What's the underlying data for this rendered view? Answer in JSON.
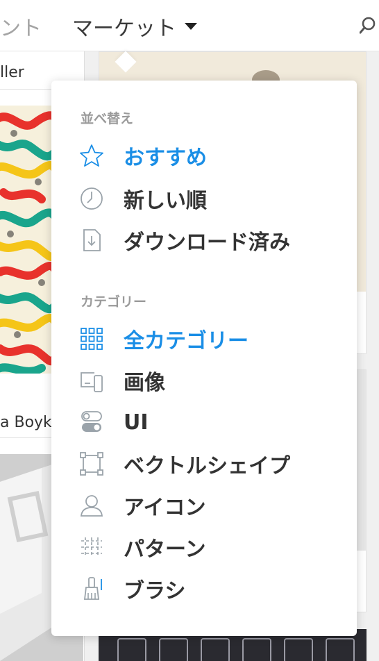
{
  "nav": {
    "partial_label": "ント",
    "market_label": "マーケット"
  },
  "background": {
    "left_card_top_label": "ller",
    "left_card_bottom_label": "a Boyk"
  },
  "dropdown": {
    "sort_header": "並べ替え",
    "sort_items": [
      {
        "label": "おすすめ",
        "icon": "star-icon",
        "active": true
      },
      {
        "label": "新しい順",
        "icon": "clock-icon",
        "active": false
      },
      {
        "label": "ダウンロード済み",
        "icon": "download-icon",
        "active": false
      }
    ],
    "category_header": "カテゴリー",
    "category_items": [
      {
        "label": "全カテゴリー",
        "icon": "grid-icon",
        "active": true
      },
      {
        "label": "画像",
        "icon": "devices-icon",
        "active": false
      },
      {
        "label": "UI",
        "icon": "toggle-icon",
        "active": false
      },
      {
        "label": "ベクトルシェイプ",
        "icon": "vector-shape-icon",
        "active": false
      },
      {
        "label": "アイコン",
        "icon": "user-icon",
        "active": false
      },
      {
        "label": "パターン",
        "icon": "pattern-icon",
        "active": false
      },
      {
        "label": "ブラシ",
        "icon": "brush-icon",
        "active": false
      }
    ]
  },
  "colors": {
    "accent": "#1a8ee6",
    "text": "#333333",
    "muted": "#9a9a9a"
  }
}
